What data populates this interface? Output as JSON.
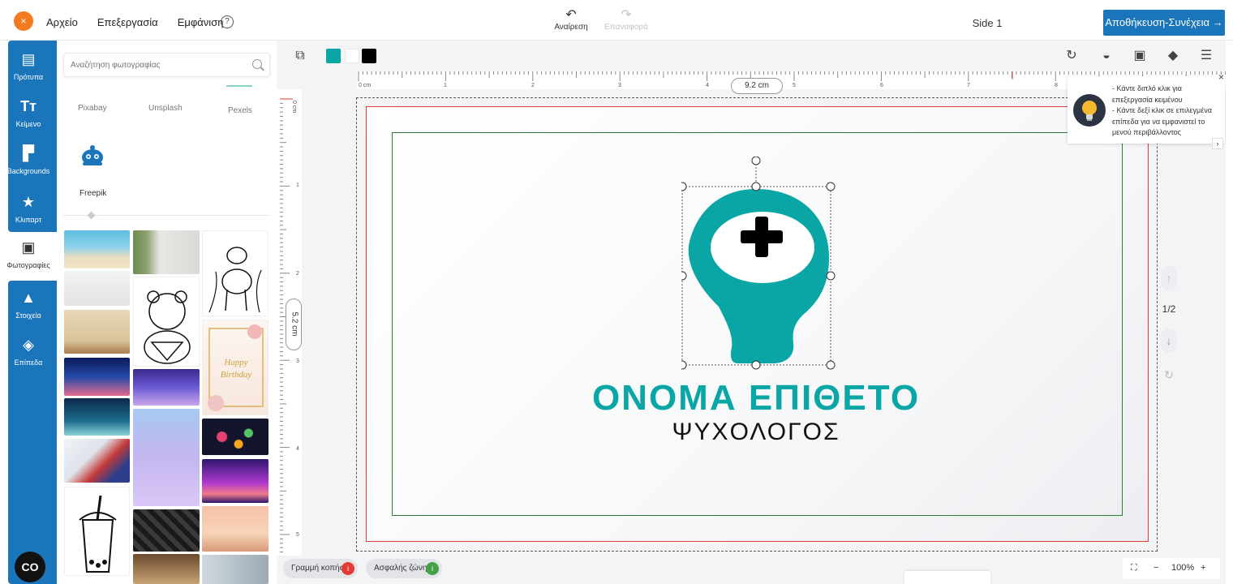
{
  "topbar": {
    "close_label": "×",
    "menu": [
      "Αρχείο",
      "Επεξεργασία",
      "Εμφάνιση"
    ],
    "help_label": "?",
    "undo_label": "Αναίρεση",
    "redo_label": "Επαναφορά",
    "doc_title": "Side 1",
    "save_label": "Αποθήκευση-Συνέχεια →"
  },
  "leftnav": {
    "items": [
      {
        "label": "Πρότυπα",
        "icon": "template-icon"
      },
      {
        "label": "Κείμενο",
        "icon": "text-icon"
      },
      {
        "label": "Backgrounds",
        "icon": "paint-roller-icon"
      },
      {
        "label": "Κλιπαρτ",
        "icon": "star-icon"
      },
      {
        "label": "Φωτογραφίες",
        "icon": "image-icon"
      },
      {
        "label": "Στοιχεία",
        "icon": "shapes-icon"
      },
      {
        "label": "Επίπεδα",
        "icon": "layers-icon"
      }
    ],
    "chat_label": "CO"
  },
  "photo_panel": {
    "search_placeholder": "Αναζήτηση φωτογραφίας",
    "sources": [
      "Pixabay",
      "Unsplash",
      "Pexels",
      "Freepik"
    ]
  },
  "toolbar": {
    "colors": [
      "#0aa6a6",
      "#ffffff",
      "#000000"
    ]
  },
  "rulers": {
    "top_ticks": [
      "0 cm",
      "1",
      "2",
      "3",
      "4",
      "5",
      "6",
      "7",
      "8"
    ],
    "left_ticks": [
      "0 cm",
      "1",
      "2",
      "3",
      "4",
      "5"
    ],
    "width_label": "9.2 cm",
    "height_label": "5.2 cm"
  },
  "card": {
    "name": "ΟΝΟΜΑ ΕΠΙΘΕΤΟ",
    "profession": "ΨΥΧΟΛΟΓΟΣ",
    "accent_color": "#0aa6a6"
  },
  "tip": {
    "line1": "- Κάντε διπλό κλικ για επεξεργασία κειμένου",
    "line2": "- Κάντε δεξί κλικ σε επιλεγμένα επίπεδα για να εμφανιστεί το μενού περιβάλλοντος"
  },
  "pages": {
    "count": "1/2"
  },
  "bottom": {
    "cut_line": "Γραμμή κοπής",
    "safe_zone": "Ασφαλής ζώνη",
    "zoom": "100%"
  }
}
